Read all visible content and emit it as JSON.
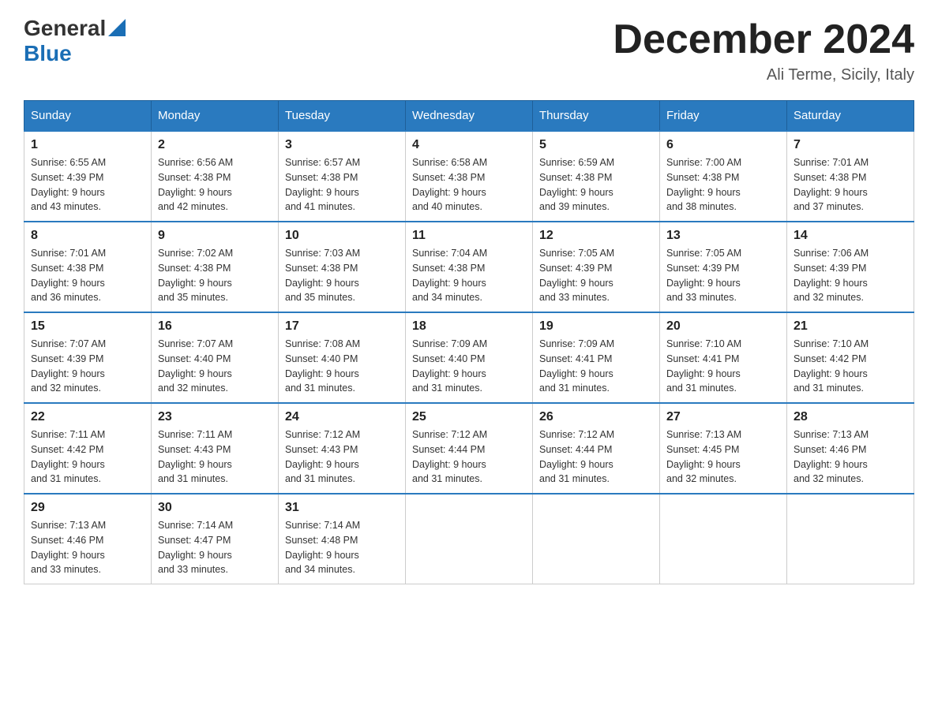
{
  "header": {
    "logo_general": "General",
    "logo_blue": "Blue",
    "month_title": "December 2024",
    "location": "Ali Terme, Sicily, Italy"
  },
  "days_of_week": [
    "Sunday",
    "Monday",
    "Tuesday",
    "Wednesday",
    "Thursday",
    "Friday",
    "Saturday"
  ],
  "weeks": [
    [
      {
        "day": "1",
        "sunrise": "Sunrise: 6:55 AM",
        "sunset": "Sunset: 4:39 PM",
        "daylight": "Daylight: 9 hours and 43 minutes."
      },
      {
        "day": "2",
        "sunrise": "Sunrise: 6:56 AM",
        "sunset": "Sunset: 4:38 PM",
        "daylight": "Daylight: 9 hours and 42 minutes."
      },
      {
        "day": "3",
        "sunrise": "Sunrise: 6:57 AM",
        "sunset": "Sunset: 4:38 PM",
        "daylight": "Daylight: 9 hours and 41 minutes."
      },
      {
        "day": "4",
        "sunrise": "Sunrise: 6:58 AM",
        "sunset": "Sunset: 4:38 PM",
        "daylight": "Daylight: 9 hours and 40 minutes."
      },
      {
        "day": "5",
        "sunrise": "Sunrise: 6:59 AM",
        "sunset": "Sunset: 4:38 PM",
        "daylight": "Daylight: 9 hours and 39 minutes."
      },
      {
        "day": "6",
        "sunrise": "Sunrise: 7:00 AM",
        "sunset": "Sunset: 4:38 PM",
        "daylight": "Daylight: 9 hours and 38 minutes."
      },
      {
        "day": "7",
        "sunrise": "Sunrise: 7:01 AM",
        "sunset": "Sunset: 4:38 PM",
        "daylight": "Daylight: 9 hours and 37 minutes."
      }
    ],
    [
      {
        "day": "8",
        "sunrise": "Sunrise: 7:01 AM",
        "sunset": "Sunset: 4:38 PM",
        "daylight": "Daylight: 9 hours and 36 minutes."
      },
      {
        "day": "9",
        "sunrise": "Sunrise: 7:02 AM",
        "sunset": "Sunset: 4:38 PM",
        "daylight": "Daylight: 9 hours and 35 minutes."
      },
      {
        "day": "10",
        "sunrise": "Sunrise: 7:03 AM",
        "sunset": "Sunset: 4:38 PM",
        "daylight": "Daylight: 9 hours and 35 minutes."
      },
      {
        "day": "11",
        "sunrise": "Sunrise: 7:04 AM",
        "sunset": "Sunset: 4:38 PM",
        "daylight": "Daylight: 9 hours and 34 minutes."
      },
      {
        "day": "12",
        "sunrise": "Sunrise: 7:05 AM",
        "sunset": "Sunset: 4:39 PM",
        "daylight": "Daylight: 9 hours and 33 minutes."
      },
      {
        "day": "13",
        "sunrise": "Sunrise: 7:05 AM",
        "sunset": "Sunset: 4:39 PM",
        "daylight": "Daylight: 9 hours and 33 minutes."
      },
      {
        "day": "14",
        "sunrise": "Sunrise: 7:06 AM",
        "sunset": "Sunset: 4:39 PM",
        "daylight": "Daylight: 9 hours and 32 minutes."
      }
    ],
    [
      {
        "day": "15",
        "sunrise": "Sunrise: 7:07 AM",
        "sunset": "Sunset: 4:39 PM",
        "daylight": "Daylight: 9 hours and 32 minutes."
      },
      {
        "day": "16",
        "sunrise": "Sunrise: 7:07 AM",
        "sunset": "Sunset: 4:40 PM",
        "daylight": "Daylight: 9 hours and 32 minutes."
      },
      {
        "day": "17",
        "sunrise": "Sunrise: 7:08 AM",
        "sunset": "Sunset: 4:40 PM",
        "daylight": "Daylight: 9 hours and 31 minutes."
      },
      {
        "day": "18",
        "sunrise": "Sunrise: 7:09 AM",
        "sunset": "Sunset: 4:40 PM",
        "daylight": "Daylight: 9 hours and 31 minutes."
      },
      {
        "day": "19",
        "sunrise": "Sunrise: 7:09 AM",
        "sunset": "Sunset: 4:41 PM",
        "daylight": "Daylight: 9 hours and 31 minutes."
      },
      {
        "day": "20",
        "sunrise": "Sunrise: 7:10 AM",
        "sunset": "Sunset: 4:41 PM",
        "daylight": "Daylight: 9 hours and 31 minutes."
      },
      {
        "day": "21",
        "sunrise": "Sunrise: 7:10 AM",
        "sunset": "Sunset: 4:42 PM",
        "daylight": "Daylight: 9 hours and 31 minutes."
      }
    ],
    [
      {
        "day": "22",
        "sunrise": "Sunrise: 7:11 AM",
        "sunset": "Sunset: 4:42 PM",
        "daylight": "Daylight: 9 hours and 31 minutes."
      },
      {
        "day": "23",
        "sunrise": "Sunrise: 7:11 AM",
        "sunset": "Sunset: 4:43 PM",
        "daylight": "Daylight: 9 hours and 31 minutes."
      },
      {
        "day": "24",
        "sunrise": "Sunrise: 7:12 AM",
        "sunset": "Sunset: 4:43 PM",
        "daylight": "Daylight: 9 hours and 31 minutes."
      },
      {
        "day": "25",
        "sunrise": "Sunrise: 7:12 AM",
        "sunset": "Sunset: 4:44 PM",
        "daylight": "Daylight: 9 hours and 31 minutes."
      },
      {
        "day": "26",
        "sunrise": "Sunrise: 7:12 AM",
        "sunset": "Sunset: 4:44 PM",
        "daylight": "Daylight: 9 hours and 31 minutes."
      },
      {
        "day": "27",
        "sunrise": "Sunrise: 7:13 AM",
        "sunset": "Sunset: 4:45 PM",
        "daylight": "Daylight: 9 hours and 32 minutes."
      },
      {
        "day": "28",
        "sunrise": "Sunrise: 7:13 AM",
        "sunset": "Sunset: 4:46 PM",
        "daylight": "Daylight: 9 hours and 32 minutes."
      }
    ],
    [
      {
        "day": "29",
        "sunrise": "Sunrise: 7:13 AM",
        "sunset": "Sunset: 4:46 PM",
        "daylight": "Daylight: 9 hours and 33 minutes."
      },
      {
        "day": "30",
        "sunrise": "Sunrise: 7:14 AM",
        "sunset": "Sunset: 4:47 PM",
        "daylight": "Daylight: 9 hours and 33 minutes."
      },
      {
        "day": "31",
        "sunrise": "Sunrise: 7:14 AM",
        "sunset": "Sunset: 4:48 PM",
        "daylight": "Daylight: 9 hours and 34 minutes."
      },
      null,
      null,
      null,
      null
    ]
  ]
}
